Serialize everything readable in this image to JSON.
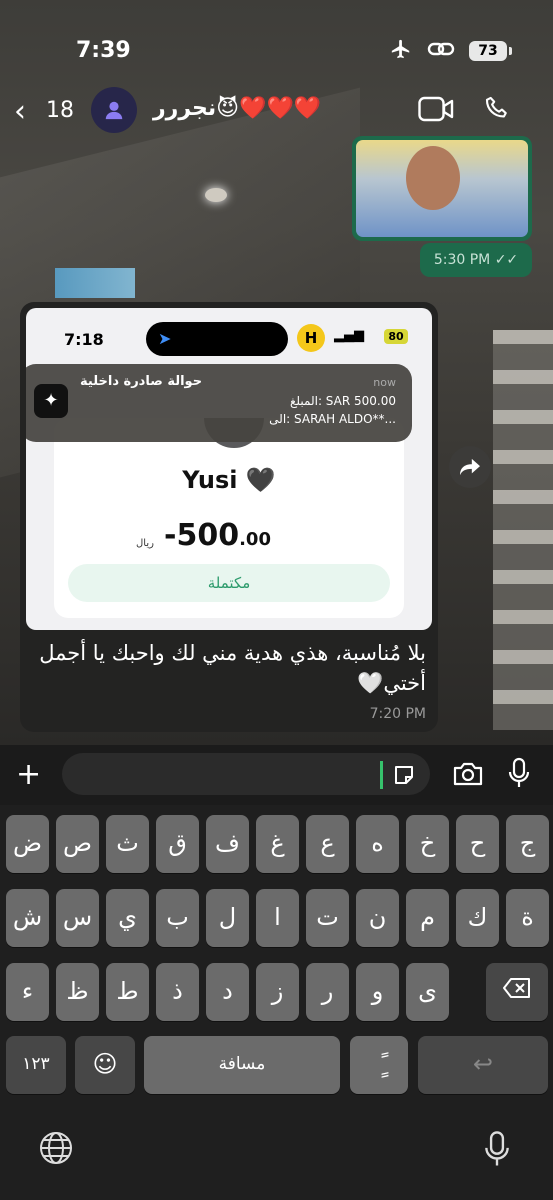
{
  "status": {
    "time": "7:39",
    "battery": "73"
  },
  "header": {
    "back_count": "18",
    "contact_name": "نجررر😈❤️❤️❤️"
  },
  "messages": {
    "image_time": "5:30 PM",
    "screenshot": {
      "time": "7:18",
      "badge": "H",
      "battery": "80",
      "notification": {
        "title": "حوالة صادرة داخلية",
        "when": "now",
        "line1": "المبلغ: SAR 500.00",
        "line2": "الى: SARAH ALDO**..."
      },
      "recipient": "Yusi 🖤",
      "amount_main": "-500",
      "amount_decimals": ".00",
      "currency": "ريال",
      "status": "مكتملة"
    },
    "text": "بلا مُناسبة، هذي هدية مني لك واحبك يا أجمل أختي🤍",
    "time": "7:20 PM"
  },
  "keyboard": {
    "row1": [
      "ض",
      "ص",
      "ث",
      "ق",
      "ف",
      "غ",
      "ع",
      "ه",
      "خ",
      "ح",
      "ج"
    ],
    "row2": [
      "ش",
      "س",
      "ي",
      "ب",
      "ل",
      "ا",
      "ت",
      "ن",
      "م",
      "ك",
      "ة"
    ],
    "row3": [
      "ء",
      "ظ",
      "ط",
      "ذ",
      "د",
      "ز",
      "ر",
      "و",
      "ى"
    ],
    "numbers": "١٢٣",
    "space": "مسافة",
    "tanween": "ًٍ"
  }
}
